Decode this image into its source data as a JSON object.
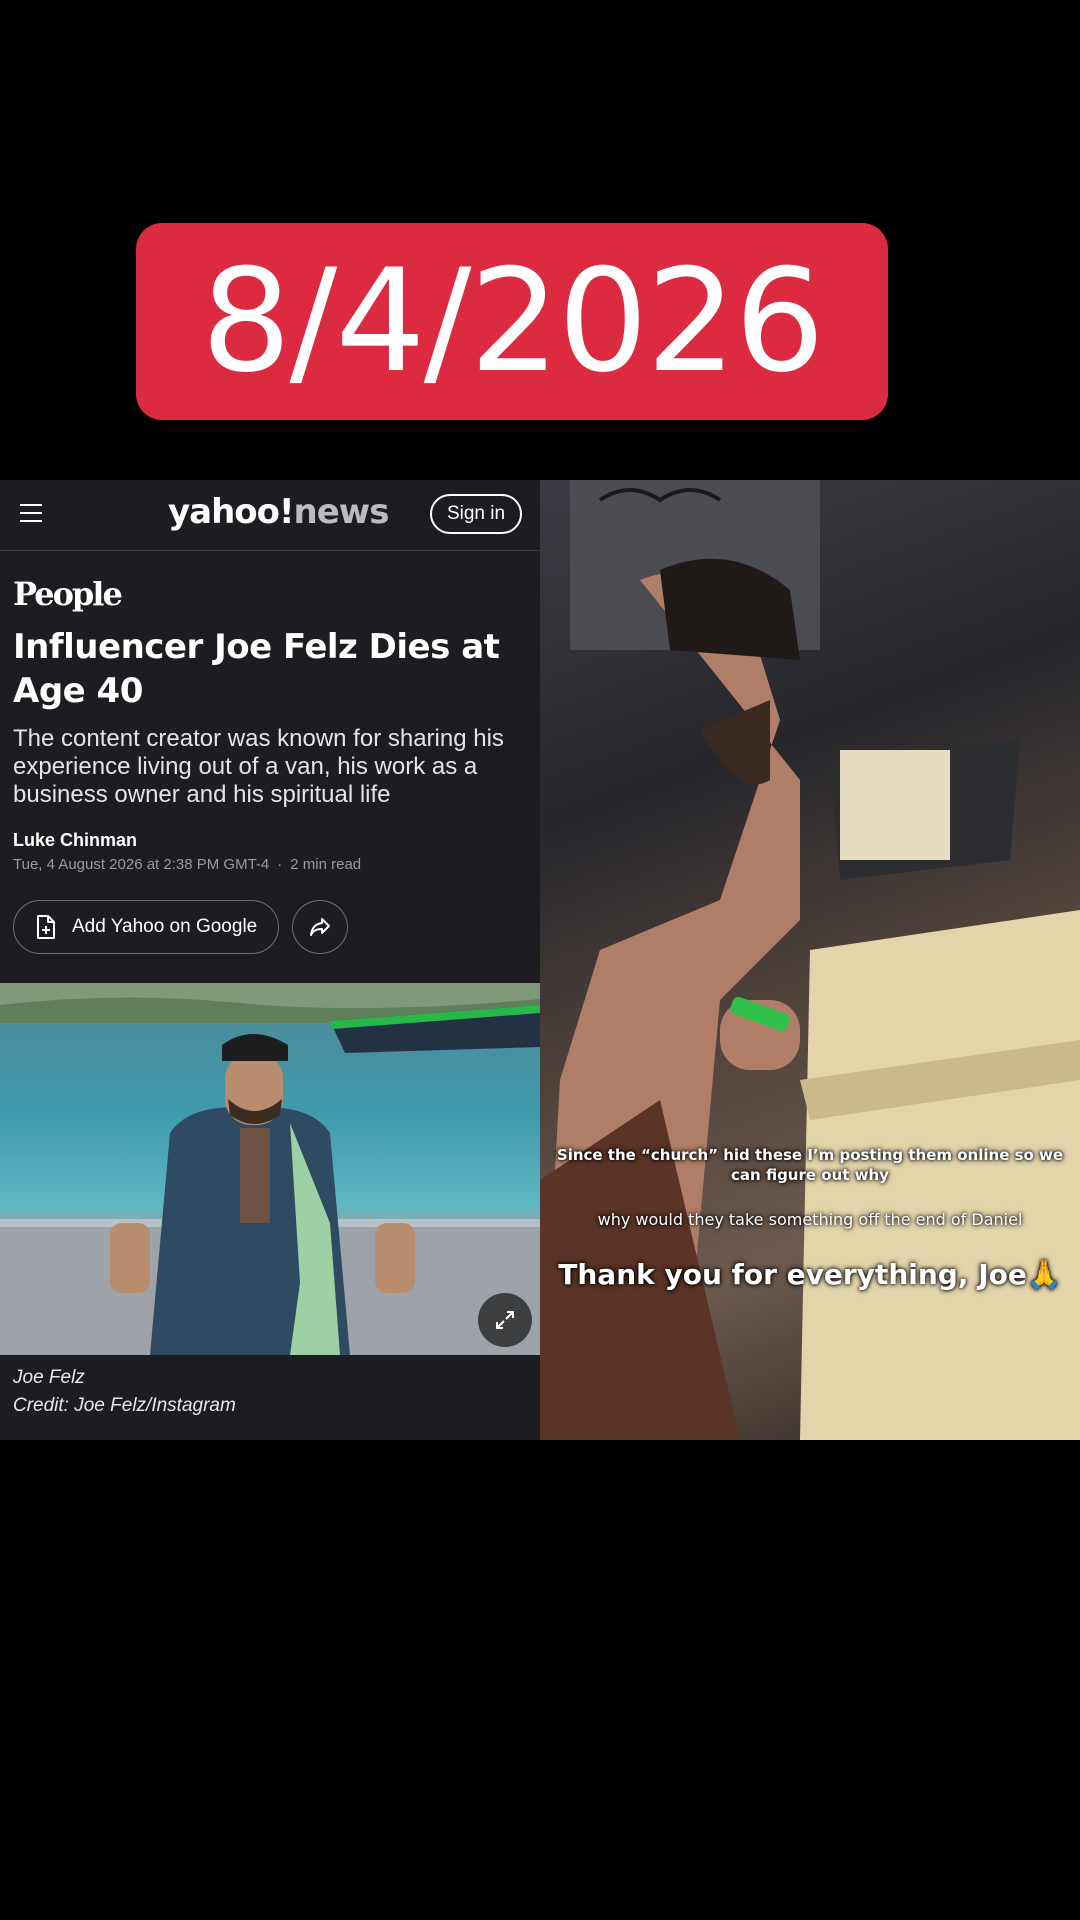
{
  "date_badge": {
    "text": "8/4/2026",
    "color": "#dc2b41"
  },
  "article": {
    "header": {
      "menu_icon": "hamburger-icon",
      "logo_yahoo": "yahoo!",
      "logo_news": "news",
      "sign_in": "Sign in"
    },
    "publisher": "People",
    "headline": "Influencer Joe Felz Dies at Age 40",
    "subhead": "The content creator was known for sharing his experience living out of a van, his work as a business owner and his spiritual life",
    "author": "Luke Chinman",
    "date": "Tue, 4 August 2026 at 2:38 PM GMT-4",
    "separator": "·",
    "read_time": "2 min read",
    "add_button": "Add Yahoo on Google",
    "add_icon": "add-document-icon",
    "share_icon": "share-icon",
    "expand_icon": "expand-icon",
    "caption_name": "Joe Felz",
    "caption_credit": "Credit: Joe Felz/Instagram"
  },
  "video": {
    "overlay_1": "Since the “church” hid these I’m posting them online so we can figure out why",
    "overlay_2": "why would they take something off the end of Daniel",
    "overlay_3": "Thank you for everything, Joe🙏"
  }
}
